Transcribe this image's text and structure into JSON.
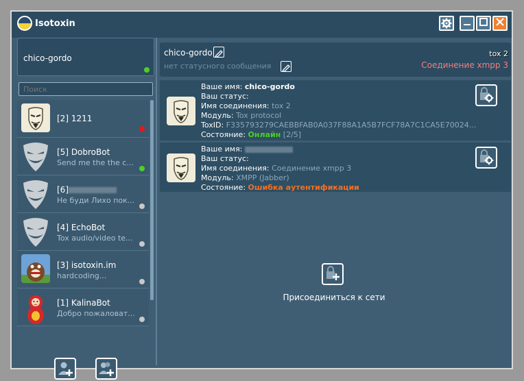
{
  "app": {
    "title": "Isotoxin"
  },
  "profile": {
    "name": "chico-gordo",
    "status_color": "#4cd027"
  },
  "search": {
    "placeholder": "Поиск"
  },
  "contacts": [
    {
      "name": "[2] 1211",
      "status": "",
      "dot_color": "#e11b1b",
      "avatar": "anon-mask-icon"
    },
    {
      "name": "[5] DobroBot",
      "status": "Send me the the c...",
      "dot_color": "#4cd027",
      "avatar": "grin-mask-icon"
    },
    {
      "name": "[6]",
      "status": "Не буди Лихо пок...",
      "dot_color": "#c8c8c8",
      "avatar": "grin-mask-icon"
    },
    {
      "name": "[4] EchoBot",
      "status": "Tox audio/video te...",
      "dot_color": "#c8c8c8",
      "avatar": "grin-mask-icon"
    },
    {
      "name": "[3] isotoxin.im",
      "status": "hardcoding...",
      "dot_color": "#c8c8c8",
      "avatar": "monster-icon"
    },
    {
      "name": "[1] KalinaBot",
      "status": "Добро пожаловат...",
      "dot_color": "#c8c8c8",
      "avatar": "matryoshka-icon"
    }
  ],
  "header": {
    "name": "chico-gordo",
    "status_placeholder": "нет статусного сообщения",
    "protocol": "tox 2",
    "connection": "Соединение xmpp 3"
  },
  "accounts": [
    {
      "name_label": "Ваше имя:",
      "name_value": "chico-gordo",
      "status_label": "Ваш статус:",
      "conn_label": "Имя соединения:",
      "conn_value": "tox 2",
      "module_label": "Модуль:",
      "module_value": "Tox protocol",
      "toxid_label": "ToxID:",
      "toxid_value": "F335793279CAEBBFAB0A037F88A1A5B7FCF78A7C1CA5E70024...",
      "state_label": "Состояние:",
      "state_value": "Онлайн",
      "state_extra": "[2/5]",
      "state_color": "#4cd027"
    },
    {
      "name_label": "Ваше имя:",
      "status_label": "Ваш статус:",
      "conn_label": "Имя соединения:",
      "conn_value": "Соединение xmpp 3",
      "module_label": "Модуль:",
      "module_value": "XMPP (Jabber)",
      "state_label": "Состояние:",
      "state_value": "Ошибка аутентификации",
      "state_color": "#f27021"
    }
  ],
  "join": {
    "label": "Присоединиться к сети"
  }
}
